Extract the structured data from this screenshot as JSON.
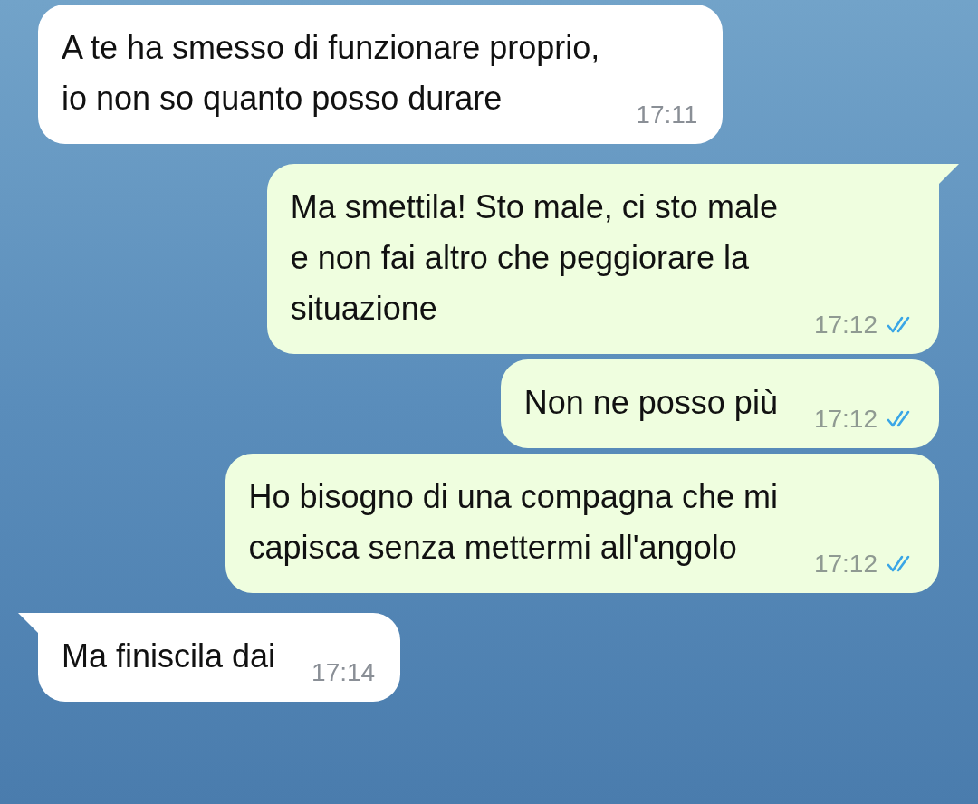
{
  "messages": [
    {
      "kind": "incoming",
      "text": "A te ha smesso di funzionare proprio,\nio non so quanto posso durare",
      "time": "17:11",
      "tail": false
    },
    {
      "kind": "outgoing",
      "text": "Ma smettila! Sto male, ci sto male\ne non fai altro che peggiorare la\nsituazione",
      "time": "17:12",
      "read": true,
      "tail": true
    },
    {
      "kind": "outgoing",
      "text": "Non ne posso più",
      "time": "17:12",
      "read": true,
      "tail": false
    },
    {
      "kind": "outgoing",
      "text": "Ho bisogno di una compagna che mi\ncapisca senza mettermi all'angolo",
      "time": "17:12",
      "read": true,
      "tail": false
    },
    {
      "kind": "incoming",
      "text": "Ma finiscila dai",
      "time": "17:14",
      "tail": true
    }
  ]
}
